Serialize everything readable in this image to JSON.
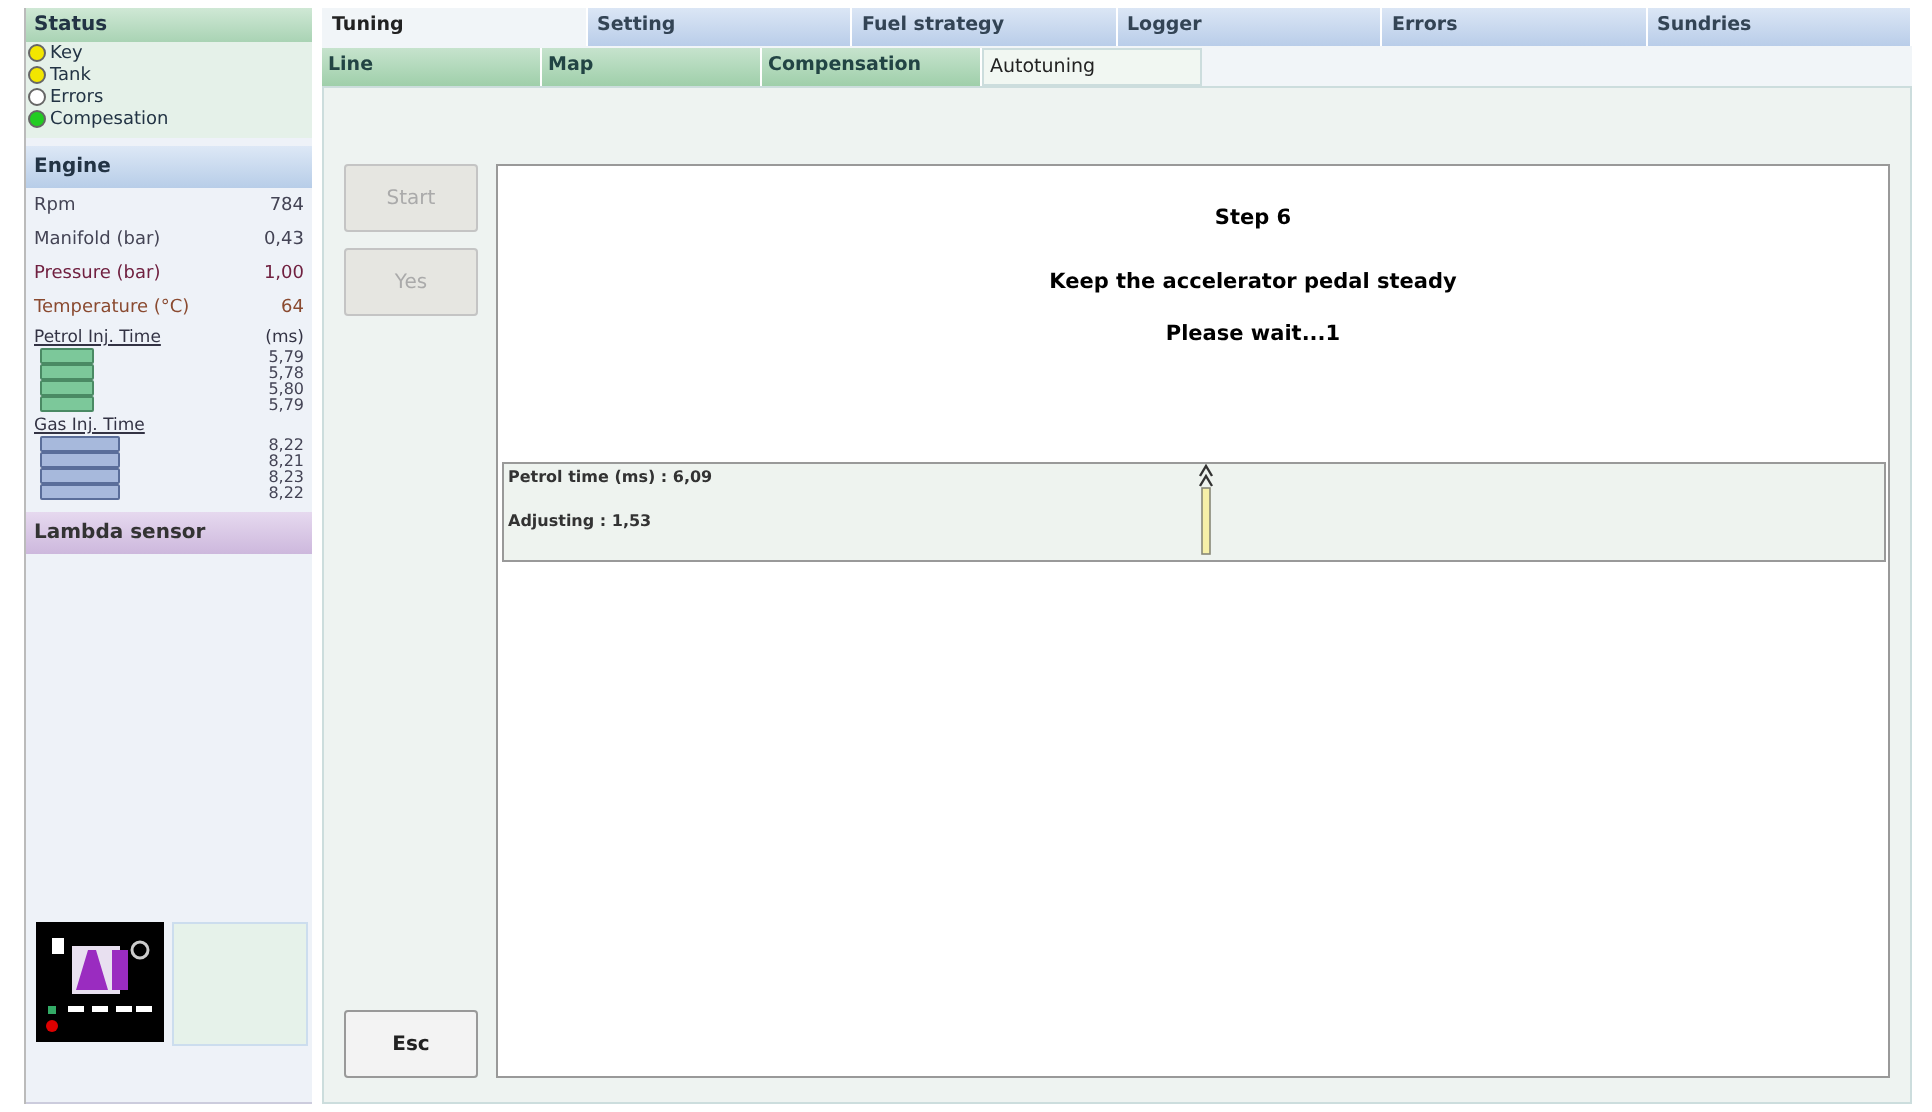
{
  "sidebar": {
    "status": {
      "title": "Status",
      "items": [
        {
          "label": "Key",
          "color": "#f2e600"
        },
        {
          "label": "Tank",
          "color": "#f2e600"
        },
        {
          "label": "Errors",
          "color": "#ffffff"
        },
        {
          "label": "Compesation",
          "color": "#22cc22"
        }
      ]
    },
    "engine": {
      "title": "Engine",
      "rows": [
        {
          "label": "Rpm",
          "value": "784",
          "kind": "plain"
        },
        {
          "label": "Manifold (bar)",
          "value": "0,43",
          "kind": "plain"
        },
        {
          "label": "Pressure (bar)",
          "value": "1,00",
          "kind": "alert"
        },
        {
          "label": "Temperature (°C)",
          "value": "64",
          "kind": "warn"
        }
      ],
      "injectors": [
        {
          "title": "Petrol Inj. Time",
          "unit": "(ms)",
          "kind": "petrol",
          "values": [
            "5,79",
            "5,78",
            "5,80",
            "5,79"
          ]
        },
        {
          "title": "Gas Inj. Time",
          "kind": "gas",
          "values": [
            "8,22",
            "8,21",
            "8,23",
            "8,22"
          ]
        }
      ]
    },
    "lambda": {
      "title": "Lambda sensor"
    }
  },
  "tabs": [
    {
      "label": "Tuning",
      "selected": true
    },
    {
      "label": "Setting",
      "selected": false
    },
    {
      "label": "Fuel strategy",
      "selected": false
    },
    {
      "label": "Logger",
      "selected": false
    },
    {
      "label": "Errors",
      "selected": false
    },
    {
      "label": "Sundries",
      "selected": false
    }
  ],
  "subtabs": [
    {
      "label": "Line",
      "selected": false
    },
    {
      "label": "Map",
      "selected": false
    },
    {
      "label": "Compensation",
      "selected": false
    },
    {
      "label": "Autotuning",
      "selected": true
    }
  ],
  "buttons": [
    {
      "label": "Start",
      "disabled": true
    },
    {
      "label": "Yes",
      "disabled": true
    }
  ],
  "esc_button": {
    "label": "Esc",
    "disabled": false
  },
  "wizard": {
    "step": "Step 6",
    "instruction": "Keep the accelerator pedal steady",
    "wait": "Please wait...1",
    "petrol_time": "Petrol time (ms) : 6,09",
    "adjusting": "Adjusting : 1,53"
  }
}
